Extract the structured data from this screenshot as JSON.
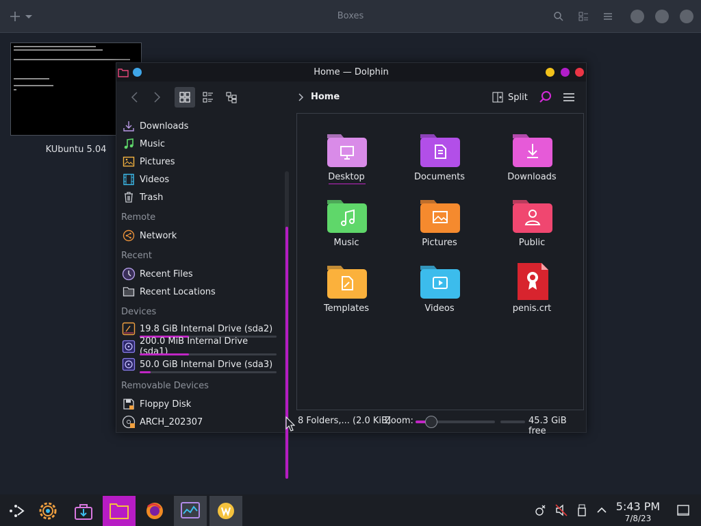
{
  "boxes": {
    "title": "Boxes"
  },
  "vm": {
    "label": "KUbuntu 5.04"
  },
  "window": {
    "title": "Home — Dolphin"
  },
  "toolbar": {
    "breadcrumb": "Home",
    "split_label": "Split"
  },
  "sidebar": {
    "places": [
      {
        "label": "Downloads",
        "icon": "download-icon"
      },
      {
        "label": "Music",
        "icon": "music-icon"
      },
      {
        "label": "Pictures",
        "icon": "pictures-icon"
      },
      {
        "label": "Videos",
        "icon": "videos-icon"
      },
      {
        "label": "Trash",
        "icon": "trash-icon"
      }
    ],
    "remote_heading": "Remote",
    "remote": [
      {
        "label": "Network",
        "icon": "network-icon"
      }
    ],
    "recent_heading": "Recent",
    "recent": [
      {
        "label": "Recent Files",
        "icon": "clock-icon"
      },
      {
        "label": "Recent Locations",
        "icon": "folder-clock-icon"
      }
    ],
    "devices_heading": "Devices",
    "devices": [
      {
        "label": "19.8 GiB Internal Drive (sda2)",
        "usage_fraction": 0.36
      },
      {
        "label": "200.0 MiB Internal Drive (sda1)",
        "usage_fraction": 0.36
      },
      {
        "label": "50.0 GiB Internal Drive (sda3)",
        "usage_fraction": 0.08
      }
    ],
    "removable_heading": "Removable Devices",
    "removable": [
      {
        "label": "Floppy Disk",
        "icon": "floppy-icon"
      },
      {
        "label": "ARCH_202307",
        "icon": "optical-disc-icon"
      }
    ]
  },
  "files": [
    {
      "label": "Desktop",
      "icon": "desktop-folder-icon",
      "color": "#d98be8"
    },
    {
      "label": "Documents",
      "icon": "documents-folder-icon",
      "color": "#b24fe8"
    },
    {
      "label": "Downloads",
      "icon": "downloads-folder-icon",
      "color": "#e65ad8"
    },
    {
      "label": "Music",
      "icon": "music-folder-icon",
      "color": "#5fd76a"
    },
    {
      "label": "Pictures",
      "icon": "pictures-folder-icon",
      "color": "#f58a2e"
    },
    {
      "label": "Public",
      "icon": "public-folder-icon",
      "color": "#f04770"
    },
    {
      "label": "Templates",
      "icon": "templates-folder-icon",
      "color": "#fbb13c"
    },
    {
      "label": "Videos",
      "icon": "videos-folder-icon",
      "color": "#3cbcec"
    },
    {
      "label": "penis.crt",
      "icon": "certificate-file-icon",
      "color": "#d8242e"
    }
  ],
  "status": {
    "count": "8 Folders,... (2.0 KiB)",
    "zoom_label": "Zoom:",
    "zoom_fraction": 0.2,
    "free_fraction": 0.0,
    "free": "45.3 GiB free"
  },
  "clock": {
    "time": "5:43 PM",
    "date": "7/8/23"
  },
  "colors": {
    "accent": "#c026c4",
    "window_bg": "#1b1e24",
    "desktop_bg": "#1c212b"
  }
}
